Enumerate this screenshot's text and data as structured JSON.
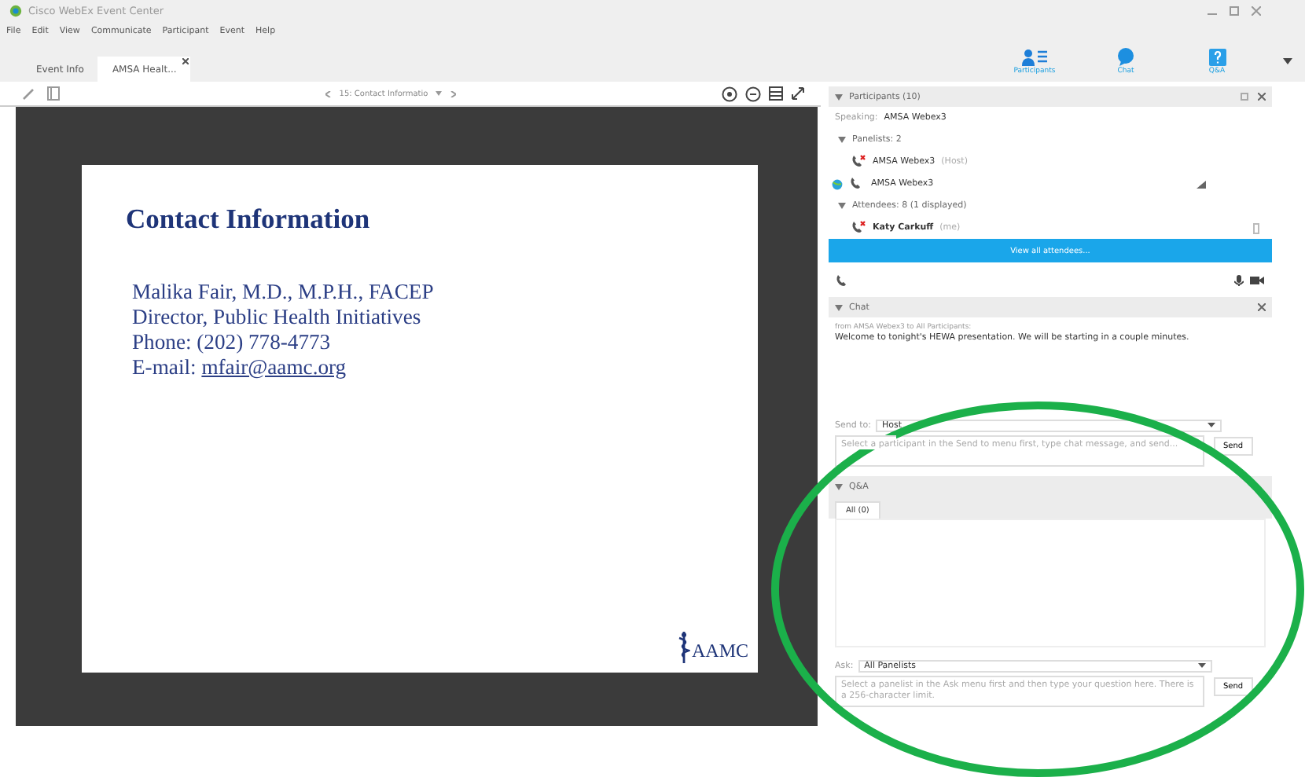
{
  "window": {
    "title": "Cisco WebEx Event Center"
  },
  "menu": [
    "File",
    "Edit",
    "View",
    "Communicate",
    "Participant",
    "Event",
    "Help"
  ],
  "tabs": [
    {
      "label": "Event Info",
      "selected": false
    },
    {
      "label": "AMSA Healt...",
      "selected": true
    }
  ],
  "panel_buttons": [
    {
      "label": "Participants",
      "kind": "participants"
    },
    {
      "label": "Chat",
      "kind": "chat"
    },
    {
      "label": "Q&A",
      "kind": "qa"
    }
  ],
  "slide_nav": {
    "label": "15: Contact Informatio"
  },
  "slide": {
    "title": "Contact Information",
    "lines": [
      "Malika Fair, M.D., M.P.H., FACEP",
      "Director, Public Health Initiatives",
      "Phone: (202) 778-4773"
    ],
    "email_label": "E-mail:",
    "email": "mfair@aamc.org",
    "logo": "AAMC"
  },
  "participants": {
    "title": "Participants (10)",
    "speaking_label": "Speaking:",
    "speaking": "AMSA Webex3",
    "groups": [
      {
        "label": "Panelists: 2",
        "expanded": true,
        "members": [
          {
            "name": "AMSA Webex3",
            "role": "(Host)",
            "kind": "host",
            "muted": true
          },
          {
            "name": "AMSA Webex3",
            "kind": "presenter",
            "muted": false
          }
        ]
      },
      {
        "label": "Attendees: 8 (1 displayed)",
        "expanded": true,
        "members": [
          {
            "name": "Katy Carkuff",
            "role": "(me)",
            "kind": "me",
            "muted": true
          }
        ]
      }
    ],
    "view_all": "View all attendees..."
  },
  "chat": {
    "title": "Chat",
    "from": "from AMSA Webex3 to All Participants:",
    "message": "Welcome to tonight's HEWA presentation. We will be starting in a couple minutes.",
    "send_to_label": "Send to:",
    "send_to": "Host",
    "placeholder": "Select a participant in the Send to menu first, type chat message, and send...",
    "send": "Send"
  },
  "qa": {
    "title": "Q&A",
    "tabs": [
      {
        "label": "All (0)",
        "selected": true
      }
    ],
    "ask_label": "Ask:",
    "ask": "All Panelists",
    "placeholder": "Select a panelist in the Ask menu first and then type your question here. There is a 256-character limit.",
    "send": "Send"
  }
}
